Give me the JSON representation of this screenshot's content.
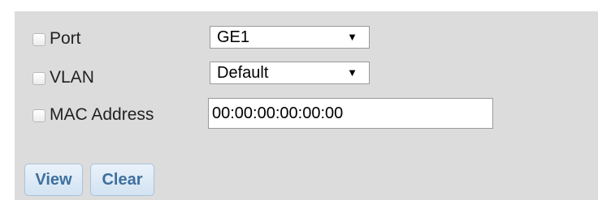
{
  "filters": {
    "port": {
      "label": "Port",
      "checked": false,
      "value": "GE1"
    },
    "vlan": {
      "label": "VLAN",
      "checked": false,
      "value": "Default"
    },
    "mac": {
      "label": "MAC Address",
      "checked": false,
      "value": "00:00:00:00:00:00"
    }
  },
  "icons": {
    "dropdown": "triangle-down-icon",
    "dropdown_glyph": "▼"
  },
  "buttons": {
    "view_label": "View",
    "clear_label": "Clear"
  },
  "colors": {
    "panel_background": "#dcdcdc",
    "button_text": "#3d6f9e",
    "button_background": "#dfeaf6",
    "button_border": "#a9c3dc"
  }
}
